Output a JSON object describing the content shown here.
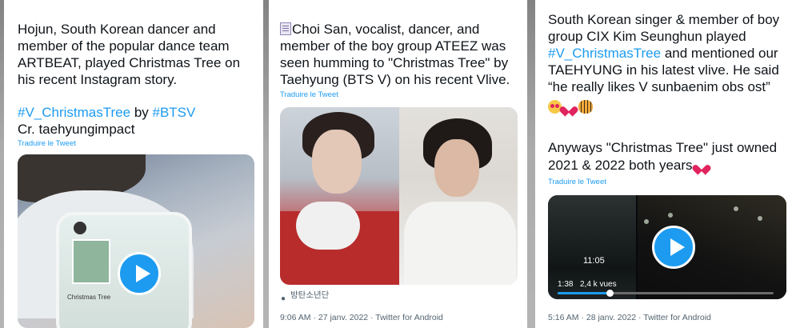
{
  "colors": {
    "link": "#1d9bf0",
    "text": "#0f1419",
    "meta": "#536471"
  },
  "tweet1": {
    "text_lines": [
      "Hojun, South Korean dancer and",
      "member of the popular dance team",
      "ARTBEAT, played Christmas Tree on",
      "his recent Instagram story."
    ],
    "hashtag1": "#V_ChristmasTree",
    "by": " by ",
    "hashtag2": "#BTSV",
    "credit": "Cr. taehyungimpact",
    "translate": "Traduire le Tweet",
    "video_caption": "Christmas Tree",
    "media_icon": "play-icon"
  },
  "tweet2": {
    "text_lines": [
      "Choi San, vocalist, dancer, and",
      "member of the boy group ATEEZ was",
      "seen humming to \"Christmas Tree\" by",
      "Taehyung (BTS V) on his recent Vlive."
    ],
    "translate": "Traduire le Tweet",
    "account": "방탄소년단",
    "meta": "9:06 AM · 27 janv. 2022 · Twitter for Android",
    "lead_icon": "document-icon"
  },
  "tweet3": {
    "text_lines": [
      "South Korean singer & member of boy",
      "group CIX Kim Seunghun played",
      " and mentioned our",
      "TAEHYUNG in his latest vlive. He said",
      "“he really likes V sunbaenim obs ost”"
    ],
    "hashtag": "#V_ChristmasTree",
    "line_b1": "Anyways \"Christmas Tree\" just owned",
    "line_b2": "2021 & 2022 both years",
    "translate": "Traduire le Tweet",
    "video_time": "11:05",
    "elapsed": "1:38",
    "views": "2,4 k vues",
    "progress_fraction": 0.24,
    "meta": "5:16 AM · 28 janv. 2022 · Twitter for Android"
  }
}
